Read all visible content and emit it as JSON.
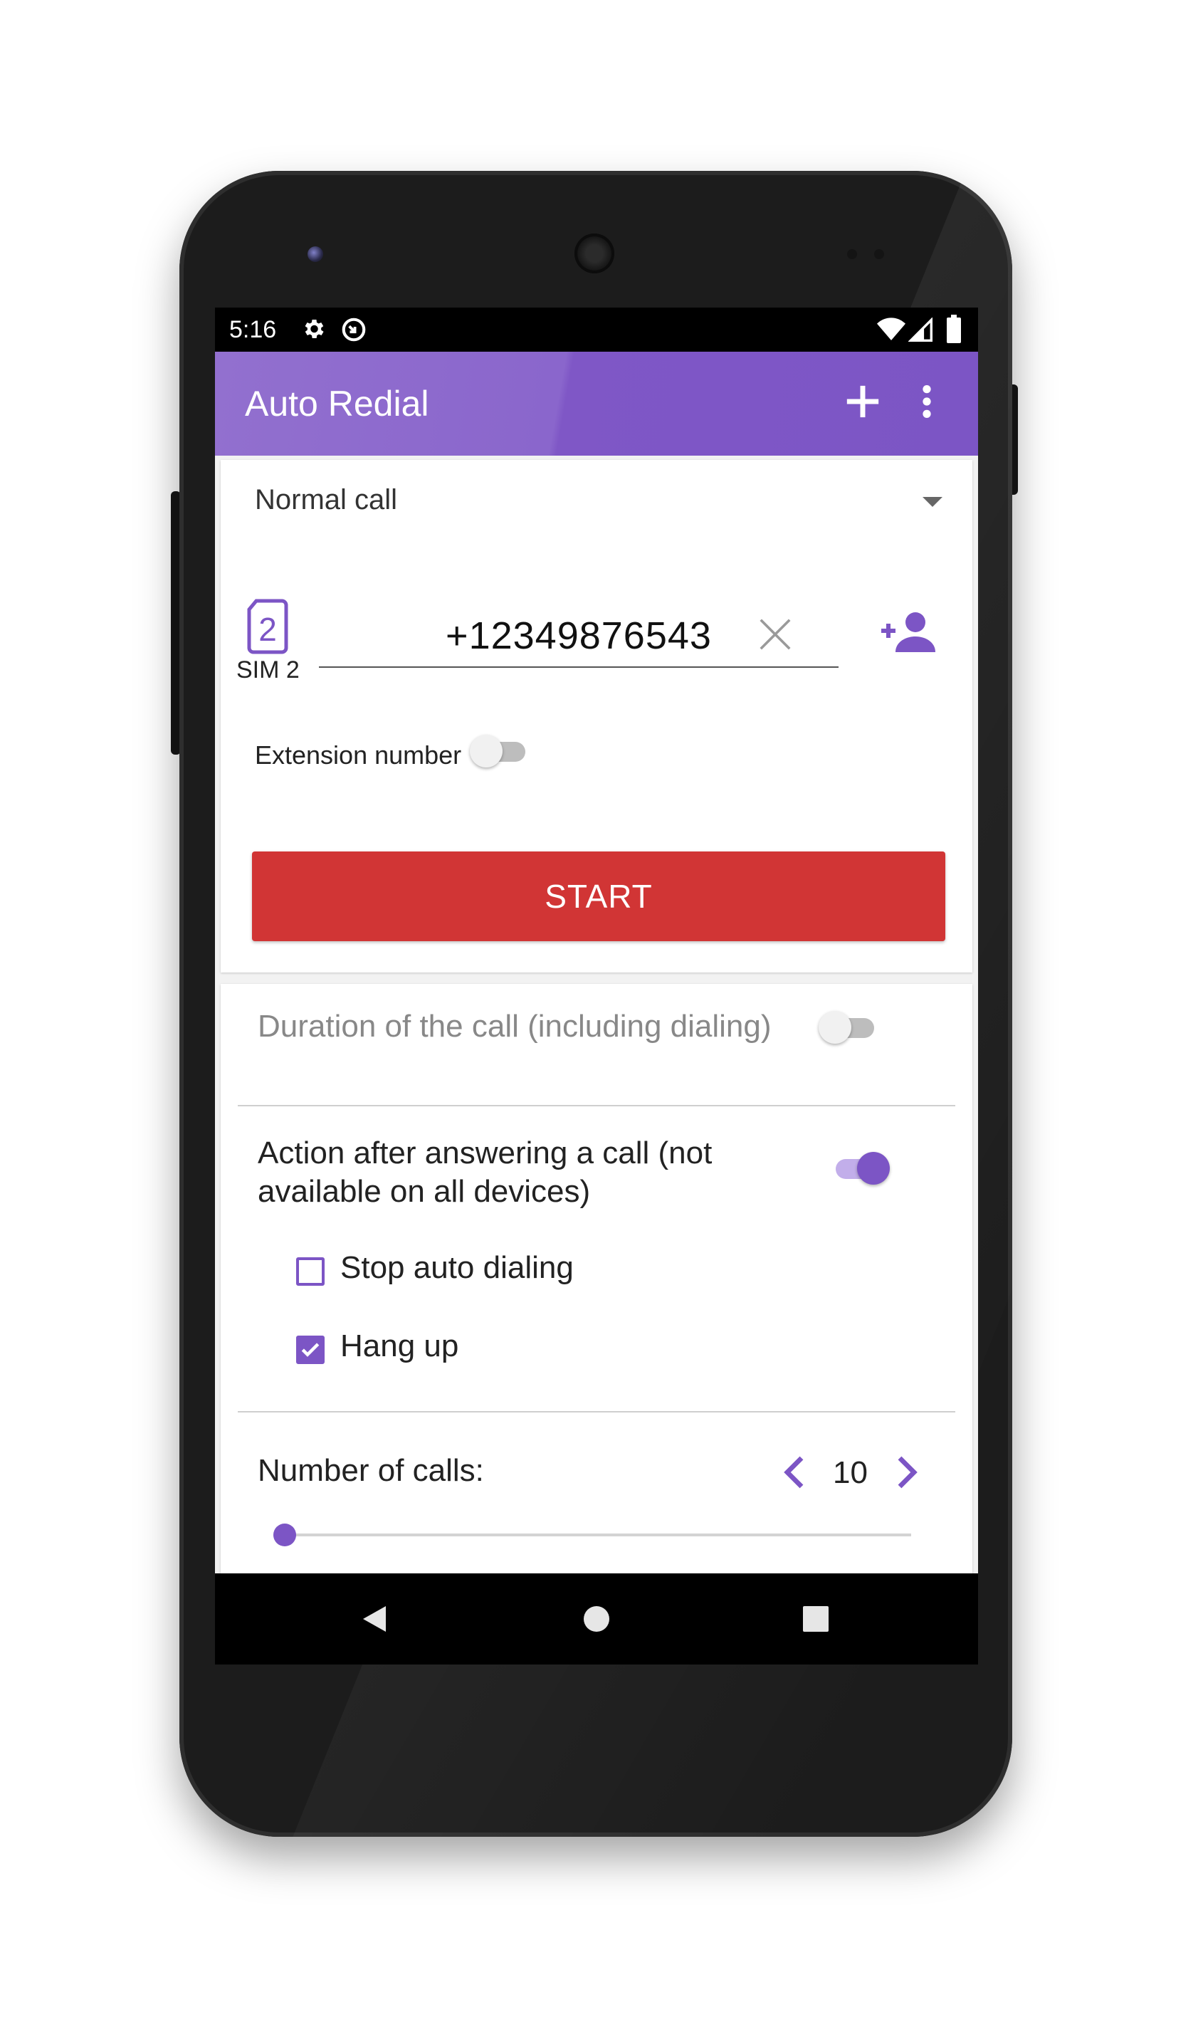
{
  "status_bar": {
    "time": "5:16",
    "icons": [
      "gear-icon",
      "data-saver-icon",
      "wifi-icon",
      "signal-icon",
      "battery-icon"
    ]
  },
  "app_bar": {
    "title": "Auto Redial",
    "actions": [
      "add-icon",
      "more-vert-icon"
    ]
  },
  "call_form": {
    "call_type": "Normal call",
    "sim_label": "SIM 2",
    "sim_number": "2",
    "phone_number": "+12349876543",
    "extension_label": "Extension number",
    "extension_enabled": false,
    "start_label": "START"
  },
  "settings": {
    "duration_label": "Duration of the call (including dialing)",
    "duration_enabled": false,
    "action_label_line1": "Action after answering a call (not",
    "action_label_line2": "available on all devices)",
    "action_enabled": true,
    "options": [
      {
        "label": "Stop auto dialing",
        "checked": false
      },
      {
        "label": "Hang up",
        "checked": true
      }
    ],
    "calls_label": "Number of calls:",
    "calls_value": "10"
  },
  "colors": {
    "accent": "#7c55c5",
    "start_button": "#d13535",
    "app_bar": "#8a66cc"
  }
}
